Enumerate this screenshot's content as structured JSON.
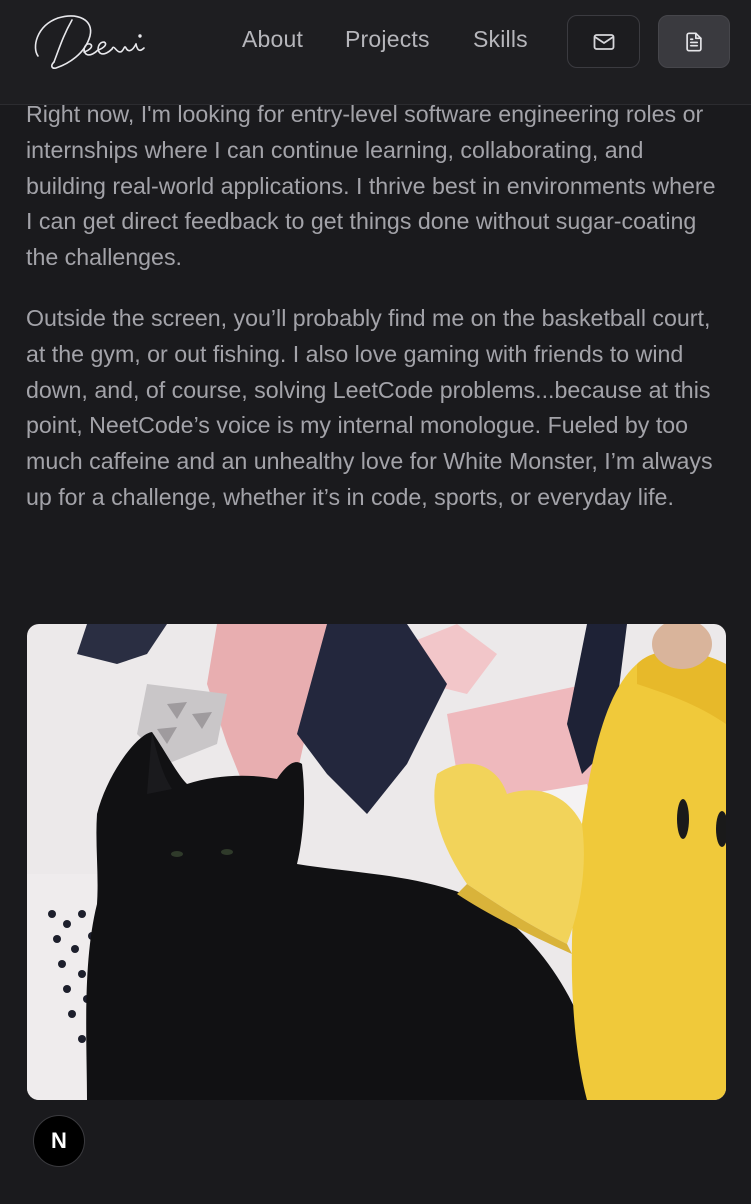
{
  "header": {
    "logo_alt": "Deevi",
    "nav": [
      {
        "label": "About"
      },
      {
        "label": "Projects"
      },
      {
        "label": "Skills"
      }
    ],
    "mail_icon": "mail-icon",
    "resume_icon": "document-icon"
  },
  "content": {
    "paragraph_1": "Right now, I'm looking for entry-level software engineering roles or internships where I can continue learning, collaborating, and building real-world applications. I thrive best in environments where I can get direct feedback to get things done without sugar-coating the challenges.",
    "paragraph_2": "Outside the screen, you’ll probably find me on the basketball court, at the gym, or out fishing. I also love gaming with friends to wind down, and, of course, solving LeetCode problems...because at this point, NeetCode’s voice is my internal monologue. Fueled by too much caffeine and an unhealthy love for White Monster, I’m always up for a challenge, whether it’s in code, sports, or everyday life."
  },
  "photo": {
    "description_icon": "photo-black-cat-with-yellow-plush"
  },
  "badge": {
    "label": "N",
    "icon": "nextjs-icon"
  },
  "colors": {
    "background": "#1a1a1d",
    "text": "#a3a3a9",
    "nav_text": "#b6b6bb"
  }
}
